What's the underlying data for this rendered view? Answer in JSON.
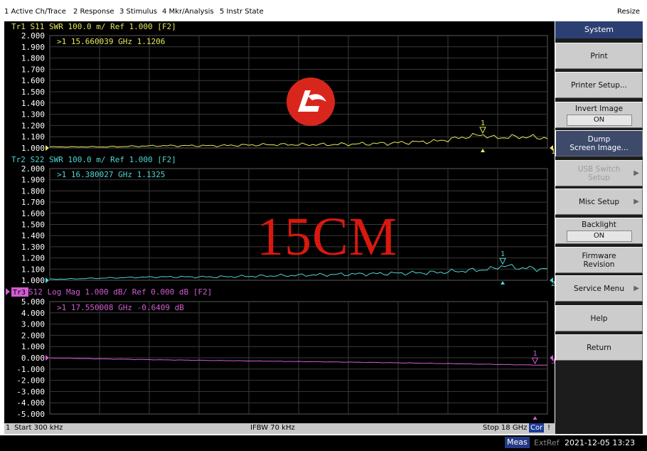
{
  "menubar": {
    "items": [
      "1 Active Ch/Trace",
      "2 Response",
      "3 Stimulus",
      "4 Mkr/Analysis",
      "5 Instr State"
    ],
    "resize_label": "Resize"
  },
  "traces": [
    {
      "header": "Tr1  S11  SWR 100.0 m/ Ref 1.000  [F2]",
      "marker_readout": ">1  15.660039 GHz  1.1206",
      "marker_label": "1",
      "end_label": "1",
      "color": "#e6e65c",
      "y_ticks": [
        "2.000",
        "1.900",
        "1.800",
        "1.700",
        "1.600",
        "1.500",
        "1.400",
        "1.300",
        "1.200",
        "1.100",
        "1.000"
      ],
      "active_indicator": false
    },
    {
      "header": "Tr2  S22  SWR 100.0 m/ Ref 1.000  [F2]",
      "marker_readout": ">1  16.380027 GHz  1.1325",
      "marker_label": "1",
      "end_label": "2",
      "color": "#4ed4d4",
      "y_ticks": [
        "2.000",
        "1.900",
        "1.800",
        "1.700",
        "1.600",
        "1.500",
        "1.400",
        "1.300",
        "1.200",
        "1.100",
        "1.000"
      ],
      "active_indicator": false
    },
    {
      "indicator_label": "Tr3",
      "header": " S12  Log Mag 1.000 dB/ Ref 0.000 dB  [F2]",
      "marker_readout": ">1  17.550008 GHz  -0.6409 dB",
      "marker_label": "1",
      "end_label": "3",
      "color": "#d25cd2",
      "y_ticks": [
        "5.000",
        "4.000",
        "3.000",
        "2.000",
        "1.000",
        "0.000",
        "-1.000",
        "-2.000",
        "-3.000",
        "-4.000",
        "-5.000"
      ],
      "active_indicator": true
    }
  ],
  "overlay": {
    "watermark_text": "15CM",
    "logo_icon": "dl-logo-icon"
  },
  "softkeys": {
    "title": "System",
    "keys": [
      {
        "label": "Print",
        "state": "",
        "style": "normal",
        "arrow": false
      },
      {
        "label": "Printer Setup...",
        "state": "",
        "style": "normal",
        "arrow": false
      },
      {
        "label": "Invert Image",
        "state": "ON",
        "style": "normal",
        "arrow": false
      },
      {
        "label": "Dump\nScreen Image...",
        "state": "",
        "style": "active",
        "arrow": false
      },
      {
        "label": "USB Switch\nSetup",
        "state": "",
        "style": "disabled",
        "arrow": true
      },
      {
        "label": "Misc Setup",
        "state": "",
        "style": "normal",
        "arrow": true
      },
      {
        "label": "Backlight",
        "state": "ON",
        "style": "normal",
        "arrow": false
      },
      {
        "label": "Firmware\nRevision",
        "state": "",
        "style": "normal",
        "arrow": false
      },
      {
        "label": "Service Menu",
        "state": "",
        "style": "normal",
        "arrow": true
      },
      {
        "label": "Help",
        "state": "",
        "style": "normal",
        "arrow": false
      },
      {
        "label": "Return",
        "state": "",
        "style": "normal",
        "arrow": false
      }
    ]
  },
  "status": {
    "channel": "1",
    "start": "Start 300 kHz",
    "ifbw": "IFBW 70 kHz",
    "stop": "Stop 18 GHz",
    "cor": "Cor",
    "excl": "!"
  },
  "bottom": {
    "meas": "Meas",
    "extref": "ExtRef",
    "datetime": "2021-12-05 13:23"
  },
  "chart_data": [
    {
      "type": "line",
      "title": "Tr1 S11 SWR",
      "x_range": [
        0.0003,
        18
      ],
      "ylim": [
        1.0,
        2.0
      ],
      "series": [
        {
          "name": "S11",
          "x": [
            0.3,
            2,
            4,
            6,
            8,
            10,
            12,
            14,
            15.66,
            16,
            17,
            18
          ],
          "y": [
            1.01,
            1.01,
            1.02,
            1.02,
            1.03,
            1.03,
            1.04,
            1.06,
            1.1206,
            1.09,
            1.1,
            1.09
          ]
        }
      ],
      "markers": [
        {
          "label": "1",
          "x": 15.660039,
          "y": 1.1206
        }
      ]
    },
    {
      "type": "line",
      "title": "Tr2 S22 SWR",
      "x_range": [
        0.0003,
        18
      ],
      "ylim": [
        1.0,
        2.0
      ],
      "series": [
        {
          "name": "S22",
          "x": [
            0.3,
            2,
            4,
            6,
            8,
            10,
            12,
            14,
            16,
            16.38,
            17,
            18
          ],
          "y": [
            1.01,
            1.02,
            1.03,
            1.03,
            1.04,
            1.05,
            1.06,
            1.07,
            1.1,
            1.1325,
            1.11,
            1.1
          ]
        }
      ],
      "markers": [
        {
          "label": "1",
          "x": 16.380027,
          "y": 1.1325
        }
      ]
    },
    {
      "type": "line",
      "title": "Tr3 S12 Log Mag",
      "x_range": [
        0.0003,
        18
      ],
      "ylim": [
        -5.0,
        5.0
      ],
      "series": [
        {
          "name": "S12",
          "x": [
            0.3,
            2,
            4,
            6,
            8,
            10,
            12,
            14,
            16,
            17.55,
            18
          ],
          "y": [
            -0.02,
            -0.1,
            -0.18,
            -0.24,
            -0.3,
            -0.36,
            -0.42,
            -0.5,
            -0.58,
            -0.6409,
            -0.66
          ]
        }
      ],
      "markers": [
        {
          "label": "1",
          "x": 17.550008,
          "y": -0.6409
        }
      ]
    }
  ]
}
